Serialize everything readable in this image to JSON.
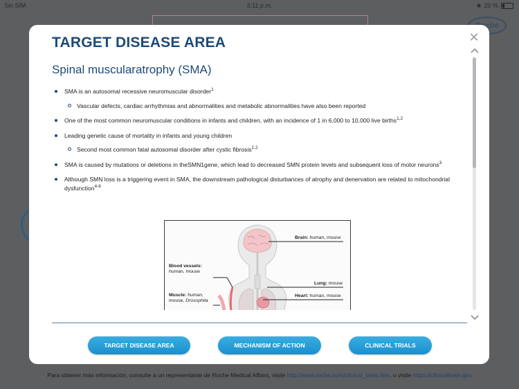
{
  "statusbar": {
    "carrier": "Sin SIM",
    "time": "3:11 p.m.",
    "battery": "20 %"
  },
  "background": {
    "logo_text": "Roche",
    "footer_text": "Para obtener más información, consulte a un representante de Roche Medical Affairs, visite ",
    "footer_link1": "http://www.roche.com/clinical_trials.htm",
    "footer_mid": ", o visite ",
    "footer_link2": "https://clinicaltrials.gov"
  },
  "modal": {
    "title": "TARGET DISEASE AREA",
    "subtitle": "Spinal muscularatrophy (SMA)",
    "bullets": {
      "b1": {
        "text": "SMA is an autosomal recessive neuromuscular disorder",
        "sup": "1"
      },
      "b1a": {
        "text": "Vascular defects, cardiac arrhythmias and abnormalities and metabolic abnormalities have also been reported",
        "sup": ""
      },
      "b2": {
        "text": "One of the most common neuromuscular conditions in infants and children, with an incidence of 1 in 6,000 to 10,000 live births",
        "sup": "1,2"
      },
      "b3": {
        "text": "Leading genetic cause of mortality in infants and young children",
        "sup": ""
      },
      "b3a": {
        "text": "Second most common fatal autosomal disorder after cystic fibrosis",
        "sup": "1,2"
      },
      "b4": {
        "text": "SMA is caused by mutations or deletions in theSMN1gene, which lead to decreased SMN protein levels and subsequent loss of motor neurons",
        "sup": "3"
      },
      "b5": {
        "text": "Although SMN loss is a triggering event in SMA, the downstream pathological disturbances of atrophy and denervation are related to mitochondrial dysfunction",
        "sup": "4-8"
      }
    },
    "figure": {
      "brain_bold": "Brain:",
      "brain_rest": " human, mouse",
      "blood_bold": "Blood vessels:",
      "blood_rest": "human, mouse",
      "lung_bold": "Lung:",
      "lung_rest": " mouse",
      "muscle_bold": "Muscle:",
      "muscle_rest1": " human,",
      "muscle_rest2": "mouse, ",
      "muscle_italic": "Drosophila",
      "heart_bold": "Heart:",
      "heart_rest": " human, mouse"
    },
    "buttons": {
      "target": "TARGET DISEASE AREA",
      "mechanism": "MECHANISM OF ACTION",
      "trials": "CLINICAL TRIALS"
    },
    "icons": {
      "close": "close-icon",
      "up": "chevron-up-icon",
      "down": "chevron-down-icon"
    }
  },
  "colors": {
    "title": "#1d4a78",
    "button": "#1a8fcf",
    "overlay": "#5c5e60"
  }
}
